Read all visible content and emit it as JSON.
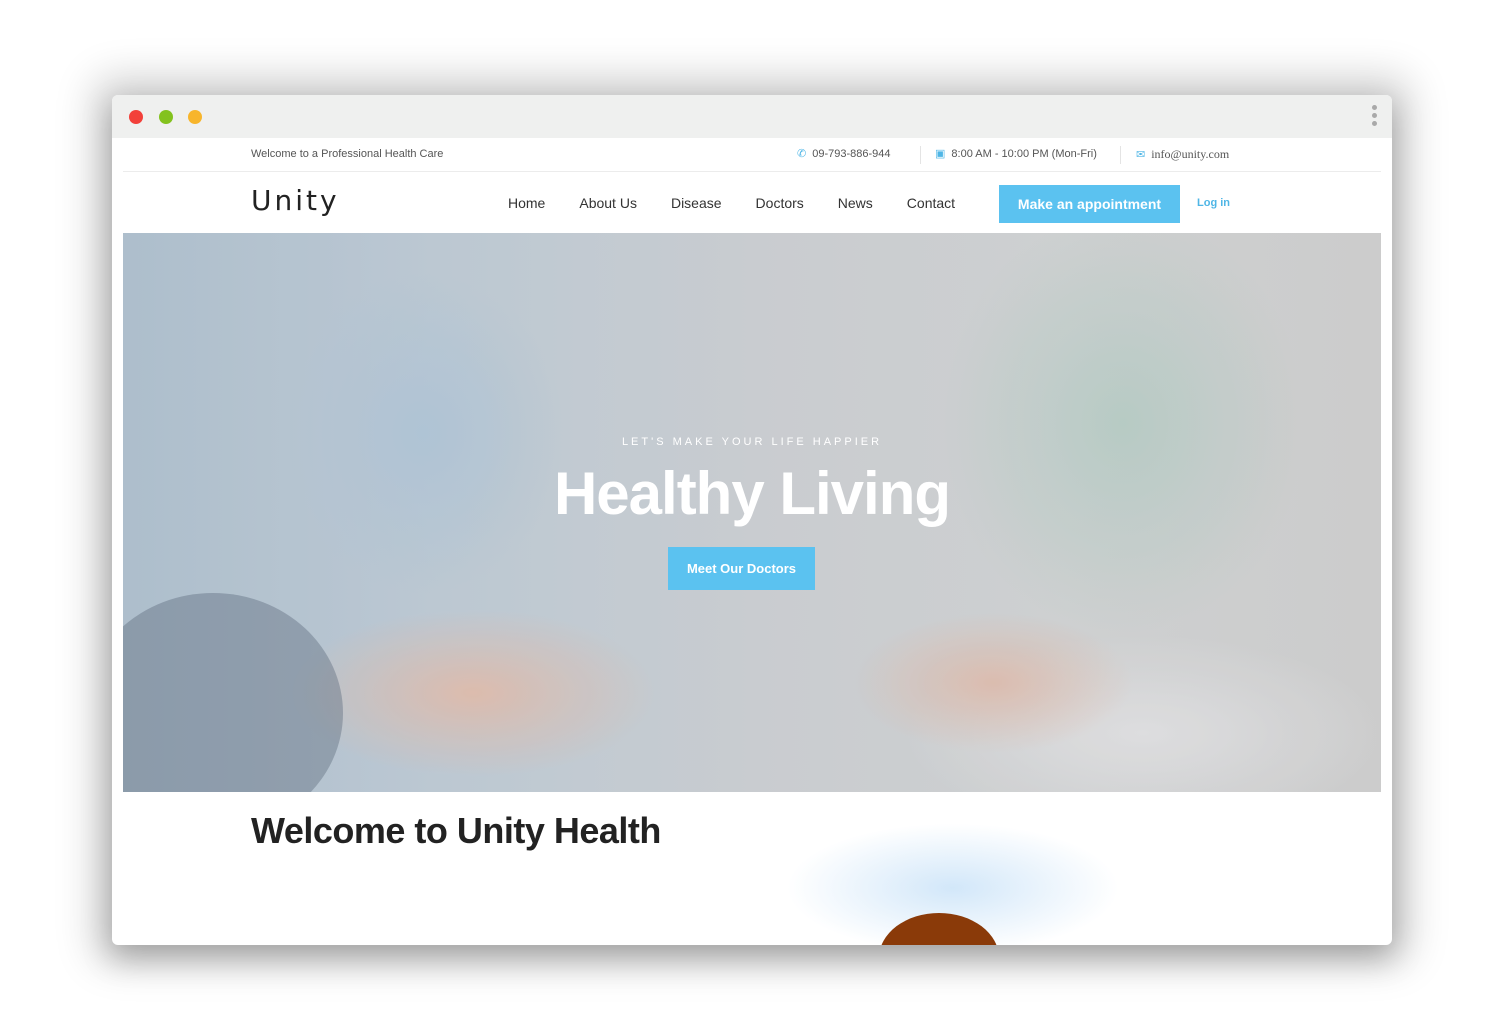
{
  "topbar": {
    "welcome": "Welcome to a Professional Health Care",
    "phone": "09-793-886-944",
    "hours": "8:00 AM - 10:00 PM (Mon-Fri)",
    "email": "info@unity.com"
  },
  "nav": {
    "logo": "Unity",
    "items": [
      "Home",
      "About Us",
      "Disease",
      "Doctors",
      "News",
      "Contact"
    ],
    "appointment_label": "Make an appointment",
    "login_label": "Log in"
  },
  "hero": {
    "kicker": "LET'S MAKE YOUR LIFE HAPPIER",
    "headline": "Healthy Living",
    "cta_label": "Meet Our Doctors"
  },
  "section": {
    "heading": "Welcome to Unity Health"
  },
  "colors": {
    "accent": "#5bc2f0",
    "close": "#f2403a",
    "minimize": "#83c21e",
    "maximize": "#f7b52c"
  },
  "icons": {
    "phone": "phone-icon",
    "hours": "calendar-icon",
    "email": "envelope-icon",
    "menu": "kebab-menu-icon"
  }
}
